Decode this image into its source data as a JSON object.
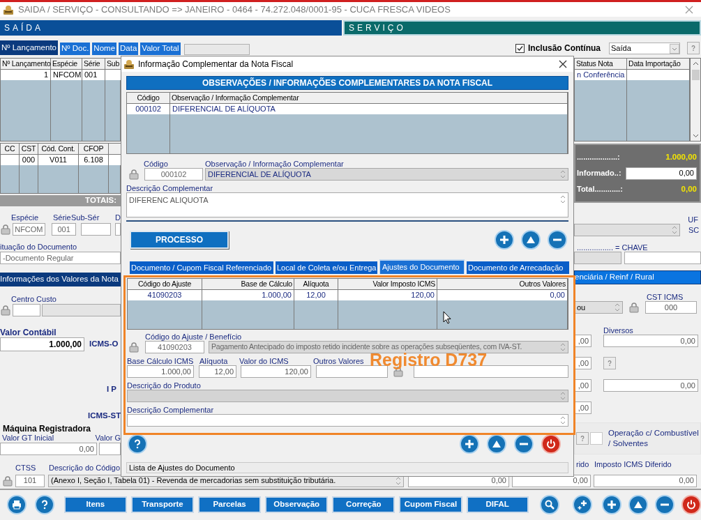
{
  "window": {
    "title": "SAIDA / SERVIÇO  -  CONSULTANDO  =>  JANEIRO  -  0464 - 74.272.048/0001-95 - CUCA FRESCA VIDEOS"
  },
  "header_bars": [
    {
      "label": "SAÍDA",
      "kind": "saida"
    },
    {
      "label": "SERVIÇO",
      "kind": "servico"
    }
  ],
  "search_tabs": [
    {
      "label": "Nº Lançamento",
      "selected": true
    },
    {
      "label": "Nº Doc.",
      "selected": false
    },
    {
      "label": "Nome",
      "selected": false
    },
    {
      "label": "Data",
      "selected": false
    },
    {
      "label": "Valor Total",
      "selected": false
    }
  ],
  "continuous_inclusion": {
    "label": "Inclusão Contínua",
    "checked": true
  },
  "mode_select": {
    "value": "Saída"
  },
  "entries_table": {
    "columns": [
      "Nº Lançamento",
      "Espécie",
      "Série",
      "Sub"
    ],
    "rows": [
      [
        "1",
        "NFCOM",
        "001",
        null
      ]
    ]
  },
  "items_table": {
    "columns": [
      "CC",
      "CST",
      "Cód. Cont.",
      "CFOP",
      null
    ],
    "rows": [
      [
        null,
        "000",
        "V011",
        "6.108",
        null
      ]
    ]
  },
  "totals_label": "TOTAIS:",
  "status_table": {
    "columns": [
      "Status Nota",
      "Data Importação"
    ],
    "rows": [
      [
        "n Conferência",
        null
      ]
    ]
  },
  "totals_panel": [
    {
      "label": "...................:",
      "value": "1.000,00",
      "kind": "highlight"
    },
    {
      "label": "Informado..:",
      "value": "0,00",
      "kind": "input"
    },
    {
      "label": "Total............:",
      "value": "0,00",
      "kind": "highlight"
    }
  ],
  "document": {
    "especie_label": "Espécie",
    "especie": "NFCOM",
    "serie_label": "Série",
    "serie": "001",
    "subserie_label": "Sub-Sér",
    "cut_label": "D",
    "situation_label": "ituação do Documento",
    "situation": "-Documento Regular",
    "uf_label": "UF",
    "uf": "SC",
    "chave_label": "................. = CHAVE"
  },
  "values_bar": "Informações dos Valores da Nota",
  "right_bar": "enciária / Reinf / Rural",
  "cost_center_label": "Centro Custo",
  "cst_icms": {
    "label": "CST ICMS",
    "value": "000",
    "select": "ou"
  },
  "valor_contabil": {
    "label": "Valor Contábil",
    "value": "1.000,00"
  },
  "tax_labels": [
    "ICMS-O",
    "I P",
    "ICMS-ST"
  ],
  "diversos": {
    "label": "Diversos",
    "value": "0,00"
  },
  "right_values": [
    ",00",
    ",00",
    ",00",
    ",00"
  ],
  "other_value": "0,00",
  "register_machine": {
    "title": "Máquina Registradora",
    "gt_initial_label": "Valor GT Inicial",
    "gt_initial": "0,00",
    "gt_final_label": "Valor G"
  },
  "fuel_operation": {
    "label": "Operação c/ Combustível / Solventes",
    "checked": false
  },
  "ctss": {
    "label": "CTSS",
    "value": "101",
    "description_label": "Descrição do Código",
    "description": "(Anexo I, Seção I, Tabela 01) - Revenda de mercadorias sem substituição tributária."
  },
  "deferred": {
    "cut_label": "rido",
    "label": "Imposto ICMS Diferido",
    "values": [
      "0,00",
      "0,00",
      "0,00"
    ]
  },
  "toolbar_buttons": [
    "Itens",
    "Transporte",
    "Parcelas",
    "Observação",
    "Correção",
    "Cupom Fiscal",
    "DIFAL"
  ],
  "dialog": {
    "title": "Informação Complementar da Nota Fiscal",
    "section_title": "OBSERVAÇÕES / INFORMAÇÕES COMPLEMENTARES DA NOTA FISCAL",
    "notes_table": {
      "columns": [
        "Código",
        "Observação / Informação Complementar"
      ],
      "rows": [
        [
          "000102",
          "DIFERENCIAL DE ALÍQUOTA"
        ]
      ]
    },
    "code_label": "Código",
    "code": "000102",
    "note_label": "Observação / Informação Complementar",
    "note": "DIFERENCIAL DE ALÍQUOTA",
    "description_label": "Descrição Complementar",
    "description": "DIFERENC ALIQUOTA",
    "process_button": "PROCESSO",
    "tabs": [
      {
        "label": "Documento / Cupom Fiscal Referenciado",
        "selected": false
      },
      {
        "label": "Local de Coleta e/ou Entrega",
        "selected": false
      },
      {
        "label": "Ajustes do Documento",
        "selected": true
      },
      {
        "label": "Documento de Arrecadação",
        "selected": false
      }
    ],
    "adjustments_table": {
      "columns": [
        "Código do Ajuste",
        "Base de Cálculo",
        "Alíquota",
        "Valor Imposto ICMS",
        "Outros Valores"
      ],
      "rows": [
        [
          "41090203",
          "1.000,00",
          "12,00",
          "120,00",
          "0,00"
        ]
      ]
    },
    "adjustment_code_label": "Código do Ajuste / Benefício",
    "adjustment_code": "41090203",
    "adjustment_description": "Pagamento Antecipado do imposto retido incidente sobre as operações subseqüentes, com IVA-ST.",
    "value_fields": [
      {
        "label": "Base Cálculo ICMS",
        "value": "1.000,00"
      },
      {
        "label": "Alíquota",
        "value": "12,00"
      },
      {
        "label": "Valor do ICMS",
        "value": "120,00"
      },
      {
        "label": "Outros Valores"
      }
    ],
    "product_description_label": "Descrição do Produto",
    "complement_label": "Descrição Complementar",
    "status_bar": "Lista de Ajustes do Documento"
  },
  "annotation": "Registro D737"
}
